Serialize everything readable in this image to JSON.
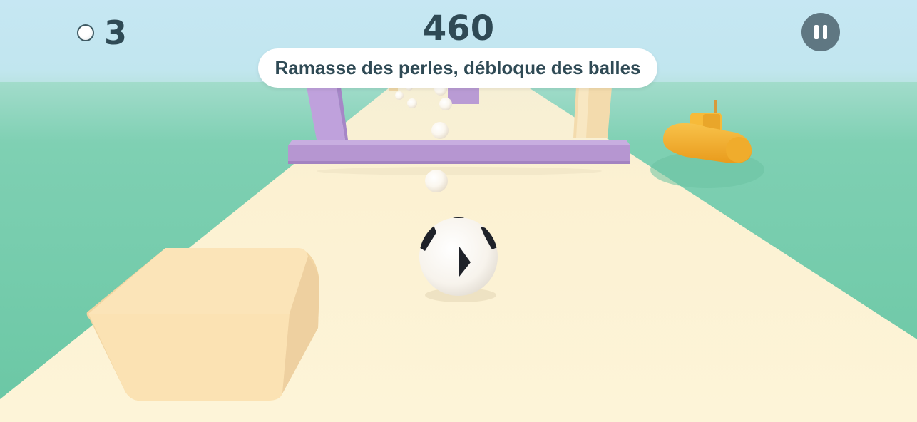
{
  "hud": {
    "pearl_icon": "pearl-icon",
    "pearl_count": "3",
    "score": "460",
    "pause_icon": "pause-icon"
  },
  "banner": {
    "text": "Ramasse des perles, débloque des balles"
  },
  "colors": {
    "sky": "#c3e6f2",
    "sea": "#6fcaa9",
    "track": "#fdf2d2",
    "gate_purple": "#b89bd6",
    "gate_beige": "#f2dcae",
    "block": "#fbe3b3",
    "submarine": "#f4b431",
    "hud_text": "#2f4a55",
    "pause_button": "#5f7782"
  },
  "scene": {
    "player_ball": "soccer-ball",
    "obstacles": [
      "purple-gate",
      "beige-post",
      "cube-block"
    ],
    "collectibles": "pearls",
    "decoration": "yellow-submarine"
  }
}
